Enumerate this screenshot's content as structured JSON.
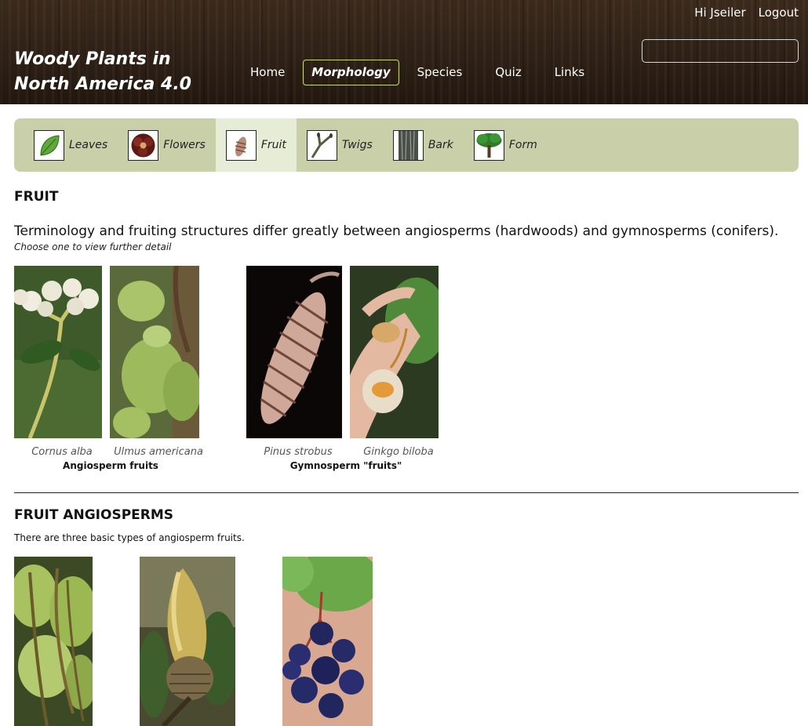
{
  "header": {
    "site_title": "Woody Plants in North America 4.0",
    "greeting": "Hi Jseiler",
    "logout_label": "Logout",
    "search_value": "",
    "nav": [
      {
        "label": "Home"
      },
      {
        "label": "Morphology"
      },
      {
        "label": "Species"
      },
      {
        "label": "Quiz"
      },
      {
        "label": "Links"
      }
    ]
  },
  "morphology_tabs": [
    {
      "label": "Leaves",
      "icon": "leaf-icon"
    },
    {
      "label": "Flowers",
      "icon": "flower-icon"
    },
    {
      "label": "Fruit",
      "icon": "cone-icon"
    },
    {
      "label": "Twigs",
      "icon": "twig-icon"
    },
    {
      "label": "Bark",
      "icon": "bark-icon"
    },
    {
      "label": "Form",
      "icon": "tree-icon"
    }
  ],
  "fruit_section": {
    "heading": "FRUIT",
    "intro": "Terminology and fruiting structures differ greatly between angiosperms (hardwoods) and gymnosperms (conifers).",
    "hint": "Choose one to view further detail",
    "photos": [
      {
        "caption": "Cornus alba"
      },
      {
        "caption": "Ulmus americana"
      },
      {
        "caption": "Pinus strobus"
      },
      {
        "caption": "Ginkgo biloba"
      }
    ],
    "angiosperm_label": "Angiosperm fruits",
    "gymnosperm_label": "Gymnosperm \"fruits\""
  },
  "angiosperm_section": {
    "heading": "FRUIT ANGIOSPERMS",
    "text": "There are three basic types of angiosperm fruits."
  },
  "colors": {
    "header_wood": "#2e2016",
    "nav_active_border": "#c9d96a",
    "subnav_bg": "#c9cfa9",
    "subnav_active_bg": "#e7ecd6"
  }
}
